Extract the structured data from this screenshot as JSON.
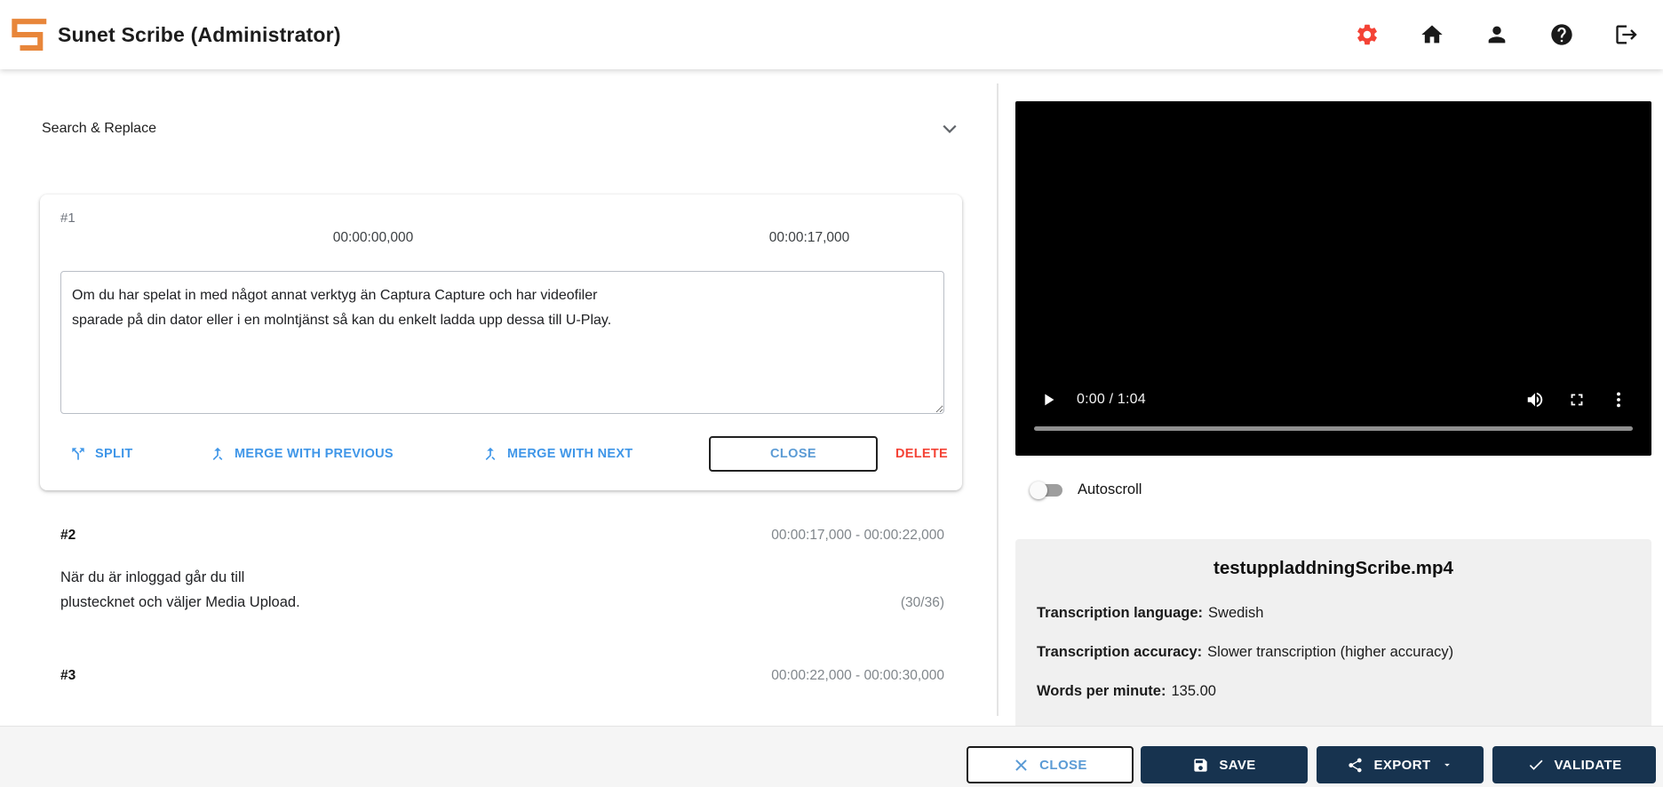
{
  "colors": {
    "accent_blue": "#3f96e8",
    "footer_navy": "#17334f",
    "danger_red": "#f44336",
    "brand_orange": "#e8863a",
    "muted_gray": "#80868b"
  },
  "header": {
    "title": "Sunet Scribe (Administrator)",
    "icons": [
      "settings-gear",
      "home",
      "user",
      "help",
      "logout"
    ]
  },
  "left": {
    "accordion_label": "Search & Replace",
    "active_segment": {
      "id": "#1",
      "start_time": "00:00:00,000",
      "end_time": "00:00:17,000",
      "text": "Om du har spelat in med något annat verktyg än Captura Capture och har videofiler\nsparade på din dator eller i en molntjänst så kan du enkelt ladda upp dessa till U-Play.",
      "actions": {
        "split": "SPLIT",
        "merge_previous": "MERGE WITH PREVIOUS",
        "merge_next": "MERGE WITH NEXT",
        "close": "CLOSE",
        "delete": "DELETE"
      }
    },
    "segments": [
      {
        "id": "#2",
        "time_range": "00:00:17,000 - 00:00:22,000",
        "lines": [
          "När du är inloggad går du till",
          "plustecknet och väljer Media Upload."
        ],
        "char_counter": "(30/36)"
      },
      {
        "id": "#3",
        "time_range": "00:00:22,000 - 00:00:30,000"
      }
    ]
  },
  "player": {
    "time_display": "0:00 / 1:04",
    "icons": [
      "play",
      "volume-up",
      "fullscreen",
      "more-options"
    ]
  },
  "autoscroll": {
    "label": "Autoscroll",
    "state": "off"
  },
  "media_info": {
    "filename": "testuppladdningScribe.mp4",
    "rows": [
      {
        "label": "Transcription language:",
        "value": "Swedish"
      },
      {
        "label": "Transcription accuracy:",
        "value": "Slower transcription (higher accuracy)"
      },
      {
        "label": "Words per minute:",
        "value": "135.00"
      }
    ]
  },
  "footer": {
    "close": "CLOSE",
    "save": "SAVE",
    "export": "EXPORT",
    "validate": "VALIDATE"
  }
}
